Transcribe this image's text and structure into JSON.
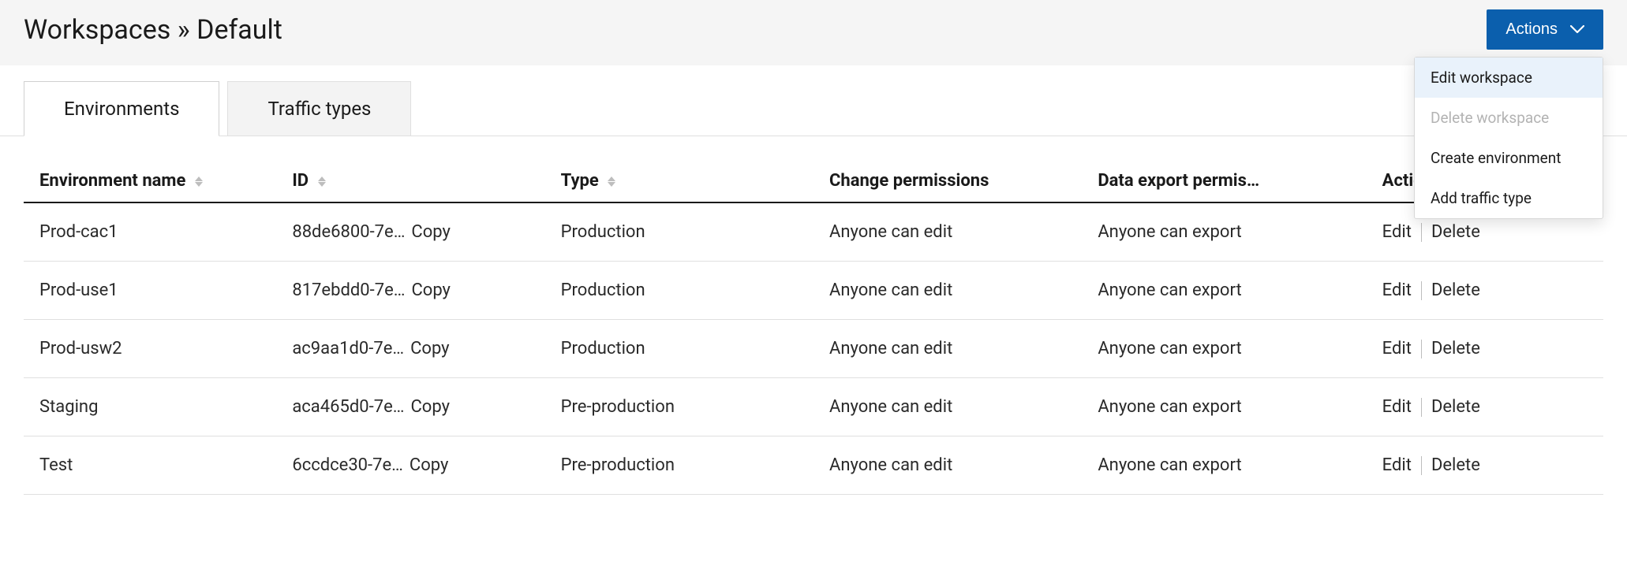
{
  "breadcrumb": {
    "root": "Workspaces",
    "separator": "»",
    "current": "Default"
  },
  "actions_button": {
    "label": "Actions"
  },
  "dropdown": {
    "items": [
      {
        "label": "Edit workspace",
        "highlight": true,
        "disabled": false
      },
      {
        "label": "Delete workspace",
        "highlight": false,
        "disabled": true
      },
      {
        "label": "Create environment",
        "highlight": false,
        "disabled": false
      },
      {
        "label": "Add traffic type",
        "highlight": false,
        "disabled": false
      }
    ]
  },
  "tabs": [
    {
      "label": "Environments",
      "active": true
    },
    {
      "label": "Traffic types",
      "active": false
    }
  ],
  "table": {
    "headers": {
      "name": "Environment name",
      "id": "ID",
      "type": "Type",
      "change": "Change permissions",
      "export": "Data export permis…",
      "actions": "Actions"
    },
    "copy_label": "Copy",
    "edit_label": "Edit",
    "delete_label": "Delete",
    "rows": [
      {
        "name": "Prod-cac1",
        "id": "88de6800-7e…",
        "type": "Production",
        "change": "Anyone can edit",
        "export": "Anyone can export"
      },
      {
        "name": "Prod-use1",
        "id": "817ebdd0-7e…",
        "type": "Production",
        "change": "Anyone can edit",
        "export": "Anyone can export"
      },
      {
        "name": "Prod-usw2",
        "id": "ac9aa1d0-7e…",
        "type": "Production",
        "change": "Anyone can edit",
        "export": "Anyone can export"
      },
      {
        "name": "Staging",
        "id": "aca465d0-7e…",
        "type": "Pre-production",
        "change": "Anyone can edit",
        "export": "Anyone can export"
      },
      {
        "name": "Test",
        "id": "6ccdce30-7e…",
        "type": "Pre-production",
        "change": "Anyone can edit",
        "export": "Anyone can export"
      }
    ]
  }
}
